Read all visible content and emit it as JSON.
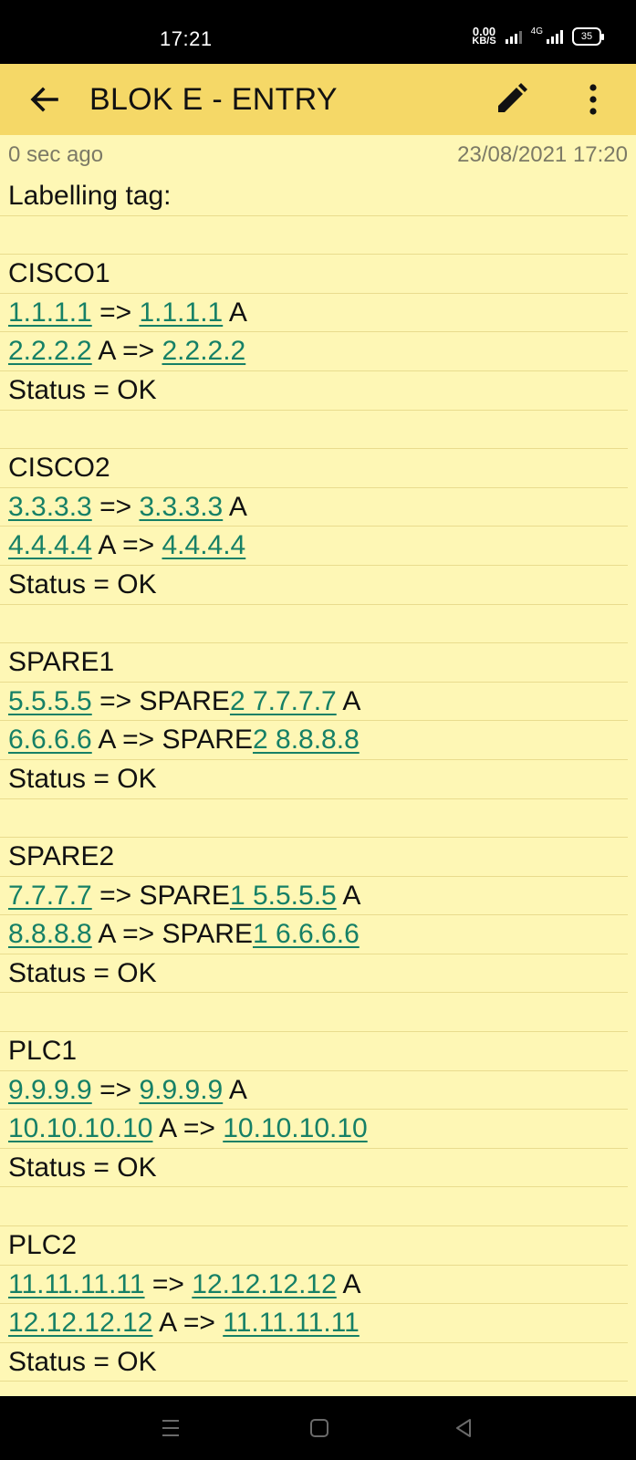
{
  "status_bar": {
    "time": "17:21",
    "net_speed_value": "0.00",
    "net_speed_unit": "KB/S",
    "network_type": "4G",
    "battery": "35"
  },
  "toolbar": {
    "title": "BLOK E - ENTRY",
    "back_icon": "arrow-left-icon",
    "edit_icon": "pencil-icon",
    "more_icon": "more-vert-icon"
  },
  "note": {
    "edited": "0 sec ago",
    "timestamp": "23/08/2021 17:20",
    "lines": [
      {
        "text": "Labelling tag:"
      },
      {
        "text": ""
      },
      {
        "text": "CISCO1"
      },
      {
        "text": "1.1.1.1 => 1.1.1.1 A"
      },
      {
        "text": "2.2.2.2 A => 2.2.2.2"
      },
      {
        "text": "Status = OK"
      },
      {
        "text": ""
      },
      {
        "text": "CISCO2"
      },
      {
        "text": "3.3.3.3 => 3.3.3.3 A"
      },
      {
        "text": "4.4.4.4 A => 4.4.4.4"
      },
      {
        "text": "Status = OK"
      },
      {
        "text": ""
      },
      {
        "text": "SPARE1"
      },
      {
        "text": "5.5.5.5 => SPARE2 7.7.7.7 A"
      },
      {
        "text": "6.6.6.6 A => SPARE2 8.8.8.8"
      },
      {
        "text": "Status = OK"
      },
      {
        "text": ""
      },
      {
        "text": "SPARE2"
      },
      {
        "text": "7.7.7.7 => SPARE1 5.5.5.5 A"
      },
      {
        "text": "8.8.8.8 A => SPARE1 6.6.6.6"
      },
      {
        "text": "Status = OK"
      },
      {
        "text": ""
      },
      {
        "text": "PLC1"
      },
      {
        "text": "9.9.9.9 => 9.9.9.9 A"
      },
      {
        "text": "10.10.10.10 A => 10.10.10.10"
      },
      {
        "text": "Status = OK"
      },
      {
        "text": ""
      },
      {
        "text": "PLC2"
      },
      {
        "text": "11.11.11.11 => 12.12.12.12 A"
      },
      {
        "text": "12.12.12.12 A => 11.11.11.11"
      },
      {
        "text": "Status = OK"
      }
    ]
  },
  "nav_bar": {
    "recents_icon": "menu-lines-icon",
    "home_icon": "square-icon",
    "back_icon": "triangle-back-icon"
  },
  "colors": {
    "toolbar_bg": "#f5d867",
    "note_bg": "#fef7b5",
    "link": "#168066"
  }
}
